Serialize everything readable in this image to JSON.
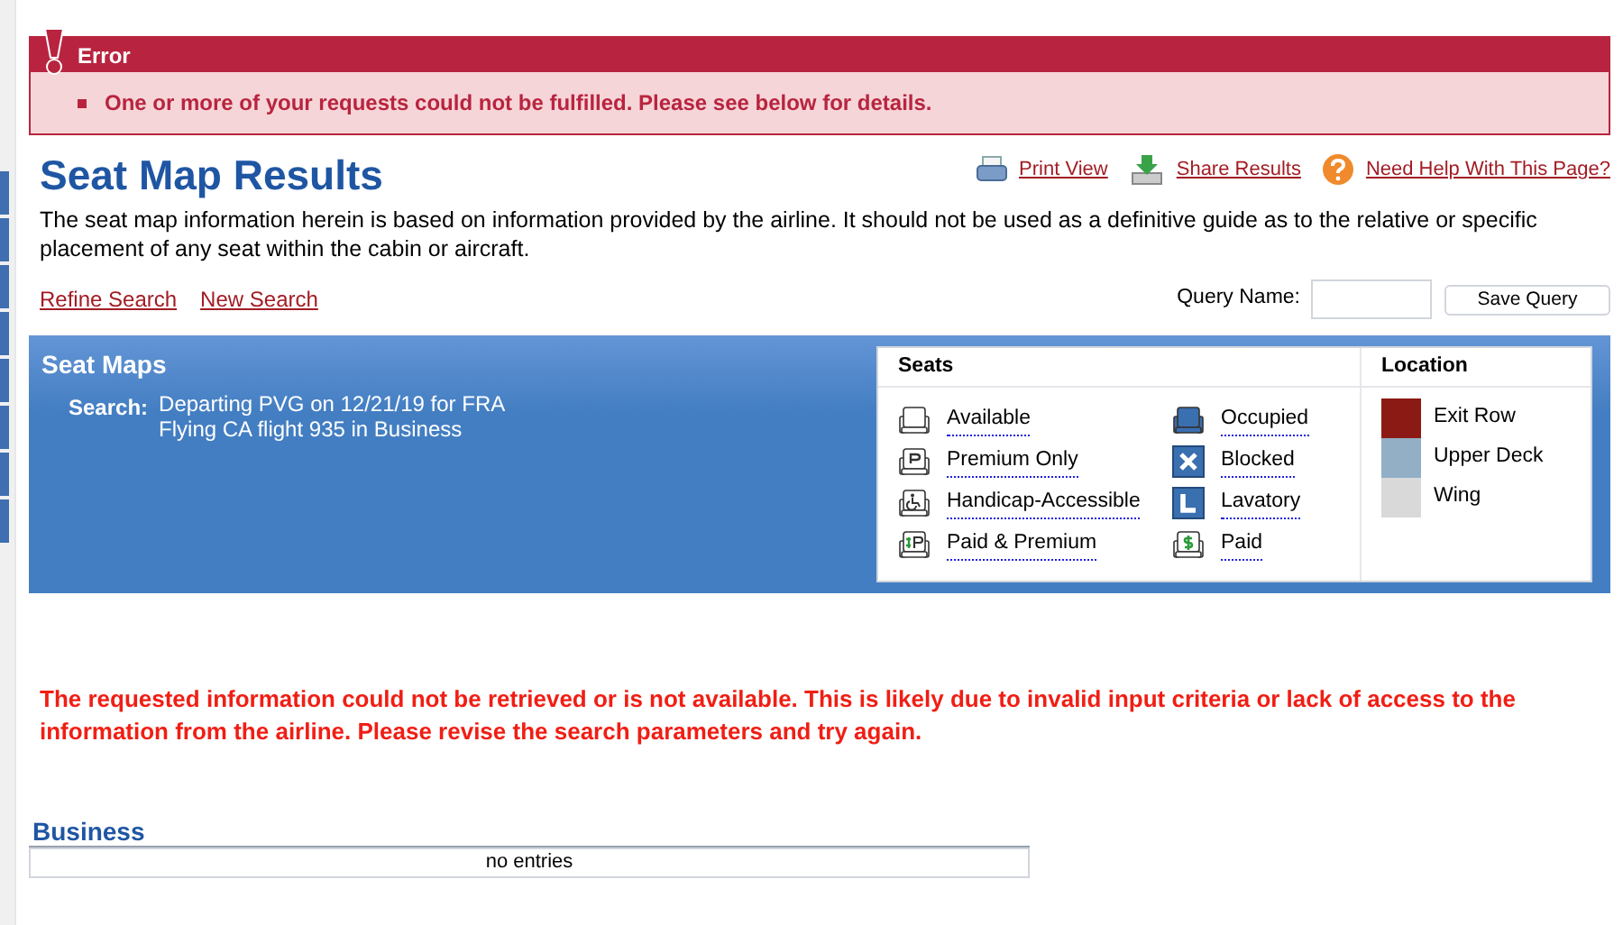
{
  "error": {
    "title": "Error",
    "messages": [
      "One or more of your requests could not be fulfilled. Please see below for details."
    ]
  },
  "page": {
    "title": "Seat Map Results",
    "tools": [
      {
        "kind": "print",
        "label": "Print View"
      },
      {
        "kind": "share",
        "label": "Share Results"
      },
      {
        "kind": "help",
        "label": "Need Help With This Page?"
      }
    ],
    "description": "The seat map information herein is based on information provided by the airline. It should not be used as a definitive guide as to the relative or specific placement of any seat within the cabin or aircraft.",
    "links": [
      "Refine Search",
      "New Search"
    ],
    "query": {
      "label": "Query Name:",
      "button": "Save Query"
    }
  },
  "seat_maps": {
    "title": "Seat Maps",
    "search_label": "Search:",
    "search_lines": [
      "Departing PVG on 12/21/19 for FRA",
      "Flying CA flight 935 in Business"
    ],
    "seats_heading": "Seats",
    "seats": [
      {
        "kind": "available",
        "label": "Available"
      },
      {
        "kind": "occupied",
        "label": "Occupied"
      },
      {
        "kind": "premium",
        "label": "Premium Only"
      },
      {
        "kind": "blocked",
        "label": "Blocked"
      },
      {
        "kind": "handicap",
        "label": "Handicap-Accessible"
      },
      {
        "kind": "lavatory",
        "label": "Lavatory"
      },
      {
        "kind": "paid_premium",
        "label": "Paid & Premium"
      },
      {
        "kind": "paid",
        "label": "Paid"
      }
    ],
    "location_heading": "Location",
    "locations": [
      {
        "label": "Exit Row",
        "color": "#8b1a14"
      },
      {
        "label": "Upper Deck",
        "color": "#92afc6"
      },
      {
        "label": "Wing",
        "color": "#d9d9d9"
      }
    ]
  },
  "notice": "The requested information could not be retrieved or is not available. This is likely due to invalid input criteria or lack of access to the information from the airline. Please revise the search parameters and try again.",
  "cabin": {
    "title": "Business",
    "empty": "no entries"
  }
}
